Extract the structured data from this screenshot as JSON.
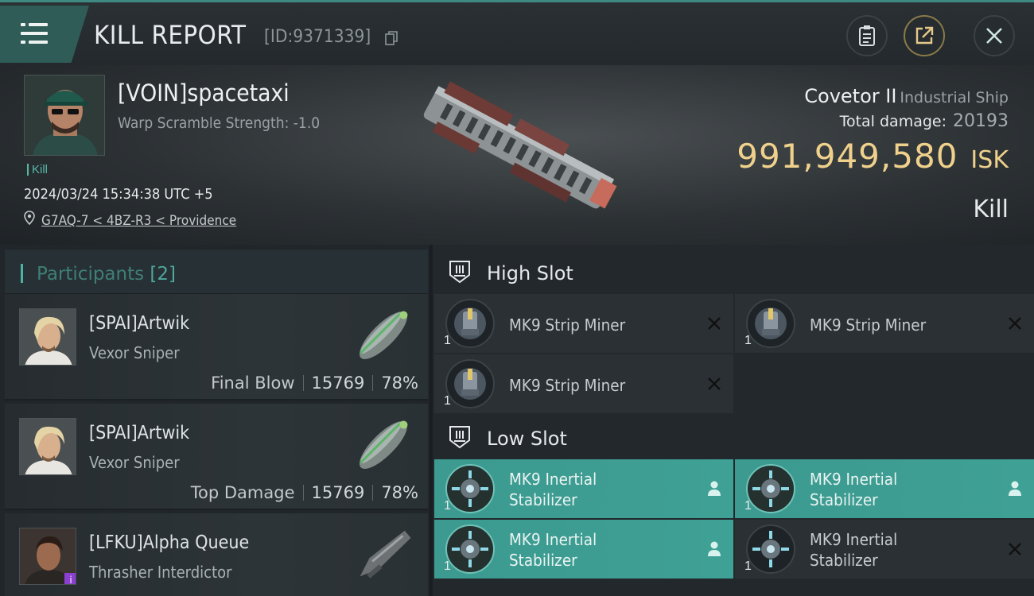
{
  "header": {
    "title": "KILL REPORT",
    "report_id": "[ID:9371339]"
  },
  "victim": {
    "name": "[VOIN]spacetaxi",
    "warp_scramble": "Warp Scramble Strength: -1.0",
    "tag": "Kill",
    "timestamp": "2024/03/24 15:34:38 UTC +5",
    "location": "G7AQ-7 < 4BZ-R3 < Providence",
    "ship_name": "Covetor II",
    "ship_class": "Industrial Ship",
    "total_damage_label": "Total damage:",
    "total_damage": "20193",
    "isk_value": "991,949,580",
    "isk_unit": "ISK",
    "result": "Kill"
  },
  "participants": {
    "label": "Participants",
    "count": "[2]",
    "rows": [
      {
        "name": "[SPAI]Artwik",
        "ship": "Vexor Sniper",
        "role": "Final Blow",
        "damage": "15769",
        "percent": "78%"
      },
      {
        "name": "[SPAI]Artwik",
        "ship": "Vexor Sniper",
        "role": "Top Damage",
        "damage": "15769",
        "percent": "78%"
      },
      {
        "name": "[LFKU]Alpha Queue",
        "ship": "Thrasher Interdictor"
      }
    ]
  },
  "fittings": {
    "high_slot": {
      "label": "High Slot",
      "modules": [
        {
          "name": "MK9 Strip Miner",
          "qty": "1",
          "status": "destroyed"
        },
        {
          "name": "MK9 Strip Miner",
          "qty": "1",
          "status": "destroyed"
        },
        {
          "name": "MK9 Strip Miner",
          "qty": "1",
          "status": "destroyed"
        }
      ]
    },
    "low_slot": {
      "label": "Low Slot",
      "modules": [
        {
          "name_line1": "MK9 Inertial",
          "name_line2": "Stabilizer",
          "qty": "1",
          "status": "dropped"
        },
        {
          "name_line1": "MK9 Inertial",
          "name_line2": "Stabilizer",
          "qty": "1",
          "status": "dropped"
        },
        {
          "name_line1": "MK9 Inertial",
          "name_line2": "Stabilizer",
          "qty": "1",
          "status": "dropped"
        },
        {
          "name_line1": "MK9 Inertial",
          "name_line2": "Stabilizer",
          "qty": "1",
          "status": "destroyed"
        }
      ]
    }
  },
  "colors": {
    "accent_teal": "#3fa095",
    "isk_gold": "#f0d18c"
  },
  "icons": [
    "menu-icon",
    "copy-icon",
    "clipboard-icon",
    "share-icon",
    "close-icon",
    "location-pin-icon",
    "high-slot-icon",
    "low-slot-icon",
    "destroyed-icon",
    "dropped-icon"
  ]
}
